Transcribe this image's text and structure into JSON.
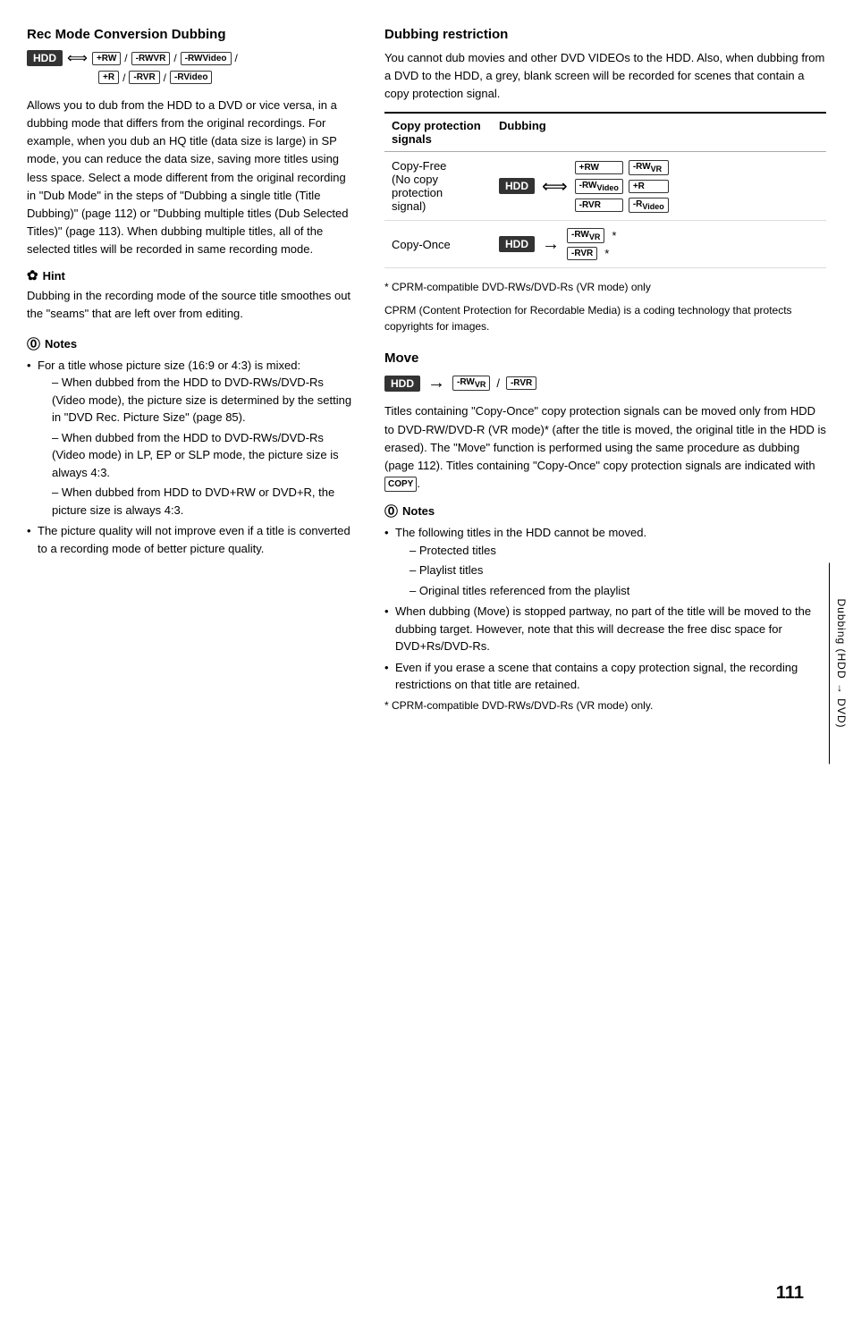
{
  "page": {
    "number": "111",
    "side_label": "Dubbing (HDD → DVD)"
  },
  "rec_mode": {
    "title": "Rec Mode Conversion Dubbing",
    "description": "Allows you to dub from the HDD to a DVD or vice versa, in a dubbing mode that differs from the original recordings. For example, when you dub an HQ title (data size is large) in SP mode, you can reduce the data size, saving more titles using less space. Select a mode different from the original recording in \"Dub Mode\" in the steps of \"Dubbing a single title (Title Dubbing)\" (page 112) or \"Dubbing multiple titles (Dub Selected Titles)\" (page 113). When dubbing multiple titles, all of the selected titles will be recorded in same recording mode."
  },
  "hint": {
    "title": "Hint",
    "text": "Dubbing in the recording mode of the source title smoothes out the \"seams\" that are left over from editing."
  },
  "notes_left": {
    "title": "Notes",
    "items": [
      "For a title whose picture size (16:9 or 4:3) is mixed:",
      "The picture quality will not improve even if a title is converted to a recording mode of better picture quality."
    ],
    "sub_items": [
      "When dubbed from the HDD to DVD-RWs/DVD-Rs (Video mode), the picture size is determined by the setting in \"DVD Rec. Picture Size\" (page 85).",
      "When dubbed from the HDD to DVD-RWs/DVD-Rs (Video mode) in LP, EP or SLP mode, the picture size is always 4:3.",
      "When dubbed from HDD to DVD+RW or DVD+R, the picture size is always 4:3."
    ]
  },
  "dubbing_restriction": {
    "title": "Dubbing restriction",
    "description": "You cannot dub movies and other DVD VIDEOs to the HDD. Also, when dubbing from a DVD to the HDD, a grey, blank screen will be recorded for scenes that contain a copy protection signal.",
    "table": {
      "col1_header": "Copy protection signals",
      "col2_header": "Dubbing",
      "row1_label": "Copy-Free (No copy protection signal)",
      "row2_label": "Copy-Once"
    }
  },
  "move": {
    "title": "Move",
    "description": "Titles containing \"Copy-Once\" copy protection signals can be moved only from HDD to DVD-RW/DVD-R (VR mode)* (after the title is moved, the original title in the HDD is erased). The \"Move\" function is performed using the same procedure as dubbing (page 112). Titles containing \"Copy-Once\" copy protection signals are indicated with",
    "copy_badge_label": "COPY",
    "footnote1": "* CPRM-compatible DVD-RWs/DVD-Rs (VR mode) only",
    "footnote2": "CPRM (Content Protection for Recordable Media) is a coding technology that protects copyrights for images."
  },
  "notes_right": {
    "title": "Notes",
    "items": [
      "The following titles in the HDD cannot be moved.",
      "When dubbing (Move) is stopped partway, no part of the title will be moved to the dubbing target. However, note that this will decrease the free disc space for DVD+Rs/DVD-Rs.",
      "Even if you erase a scene that contains a copy protection signal, the recording restrictions on that title are retained."
    ],
    "sub_items": [
      "– Protected titles",
      "– Playlist titles",
      "– Original titles referenced from the playlist"
    ],
    "footnote": "* CPRM-compatible DVD-RWs/DVD-Rs (VR mode) only."
  },
  "badges": {
    "hdd": "HDD",
    "plus_rw": "+RW",
    "minus_rwvr": "-RWVR",
    "minus_rw_video": "-RWVideo",
    "plus_r": "+R",
    "minus_rvr": "-RVR",
    "minus_r_video": "-RVideo"
  }
}
